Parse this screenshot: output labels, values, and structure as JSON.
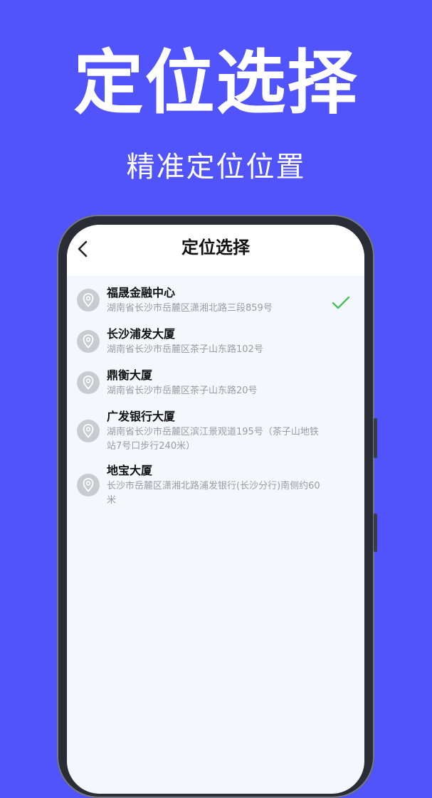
{
  "promo": {
    "title": "定位选择",
    "subtitle": "精准定位位置"
  },
  "screen": {
    "title": "定位选择",
    "back_icon": "chevron-left-icon"
  },
  "locations": [
    {
      "name": "福晟金融中心",
      "address": "湖南省长沙市岳麓区潇湘北路三段859号",
      "selected": true
    },
    {
      "name": "长沙浦发大厦",
      "address": "湖南省长沙市岳麓区茶子山东路102号",
      "selected": false
    },
    {
      "name": "鼎衡大厦",
      "address": "湖南省长沙市岳麓区茶子山东路20号",
      "selected": false
    },
    {
      "name": "广发银行大厦",
      "address": "湖南省长沙市岳麓区滨江景观道195号（茶子山地铁站7号口步行240米）",
      "selected": false
    },
    {
      "name": "地宝大厦",
      "address": "长沙市岳麓区潇湘北路浦发银行(长沙分行)南侧约60米",
      "selected": false
    }
  ],
  "colors": {
    "background": "#5153fb",
    "check": "#46c35b",
    "pin": "#c9cbd0"
  }
}
